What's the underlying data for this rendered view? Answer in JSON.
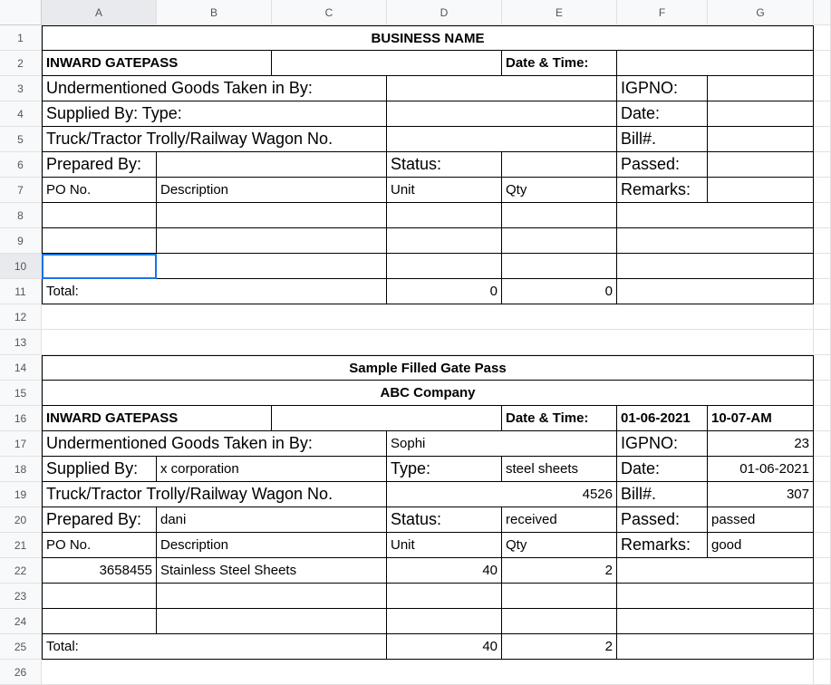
{
  "columns": [
    "A",
    "B",
    "C",
    "D",
    "E",
    "F",
    "G",
    ""
  ],
  "rows": [
    "1",
    "2",
    "3",
    "4",
    "5",
    "6",
    "7",
    "8",
    "9",
    "10",
    "11",
    "12",
    "13",
    "14",
    "15",
    "16",
    "17",
    "18",
    "19",
    "20",
    "21",
    "22",
    "23",
    "24",
    "25",
    "26"
  ],
  "selected": {
    "row": 10,
    "col": 0
  },
  "t": {
    "r1_title": "BUSINESS NAME",
    "r2_a": "INWARD GATEPASS",
    "r2_e": "Date & Time:",
    "r3_a": "Undermentioned Goods Taken in By:",
    "r3_f": "IGPNO:",
    "r4_a": "Supplied By: Type:",
    "r4_f": "Date:",
    "r5_a": "Truck/Tractor Trolly/Railway Wagon No.",
    "r5_f": "Bill#.",
    "r6_a": "Prepared By:",
    "r6_d": "Status:",
    "r6_f": "Passed:",
    "r7_a": "PO No.",
    "r7_b": "Description",
    "r7_d": "Unit",
    "r7_e": "Qty",
    "r7_f": "Remarks:",
    "r11_a": "Total:",
    "r11_d": "0",
    "r11_e": "0",
    "r14_title": "Sample Filled Gate Pass",
    "r15_title": "ABC Company",
    "r16_a": "INWARD GATEPASS",
    "r16_e": "Date & Time:",
    "r16_f": "01-06-2021",
    "r16_g": "10-07-AM",
    "r17_a": "Undermentioned Goods Taken in By:",
    "r17_d": "Sophi",
    "r17_f": "IGPNO:",
    "r17_g": "23",
    "r18_a": "Supplied By:",
    "r18_b": "x corporation",
    "r18_d": "Type:",
    "r18_e": "steel sheets",
    "r18_f": "Date:",
    "r18_g": "01-06-2021",
    "r19_a": "Truck/Tractor Trolly/Railway Wagon No.",
    "r19_e": "4526",
    "r19_f": "Bill#.",
    "r19_g": "307",
    "r20_a": "Prepared By:",
    "r20_b": "dani",
    "r20_d": "Status:",
    "r20_e": "received",
    "r20_f": "Passed:",
    "r20_g": "passed",
    "r21_a": "PO No.",
    "r21_b": "Description",
    "r21_d": "Unit",
    "r21_e": "Qty",
    "r21_f": "Remarks:",
    "r21_g": "good",
    "r22_a": "3658455",
    "r22_b": "Stainless Steel Sheets",
    "r22_d": "40",
    "r22_e": "2",
    "r25_a": "Total:",
    "r25_d": "40",
    "r25_e": "2"
  }
}
